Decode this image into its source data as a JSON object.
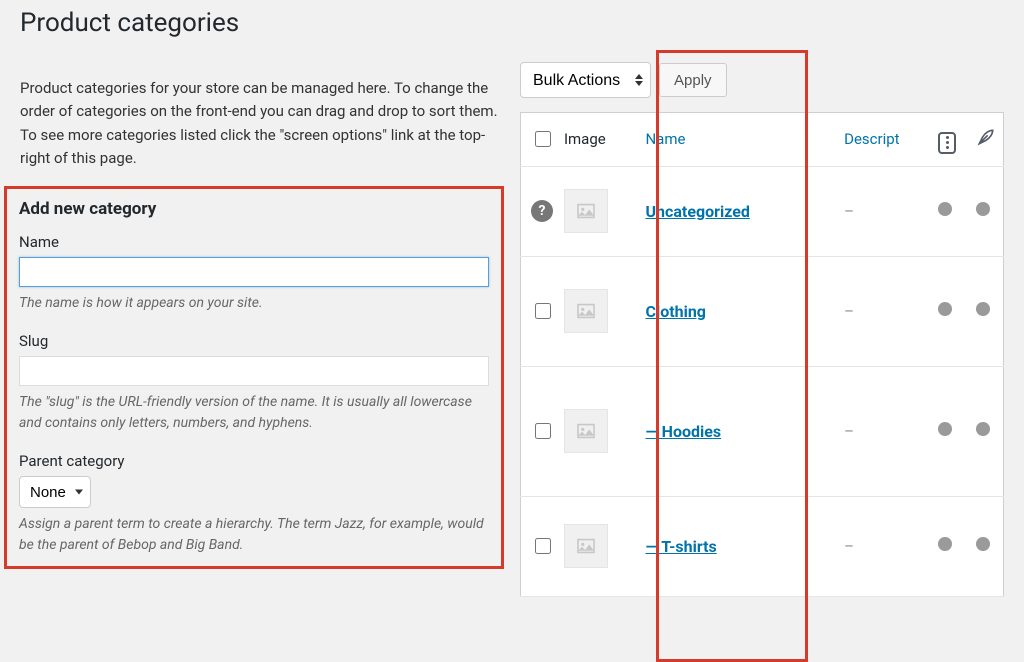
{
  "page": {
    "title": "Product categories",
    "intro": "Product categories for your store can be managed here. To change the order of categories on the front-end you can drag and drop to sort them. To see more categories listed click the \"screen options\" link at the top-right of this page."
  },
  "form": {
    "heading": "Add new category",
    "name": {
      "label": "Name",
      "value": "",
      "help": "The name is how it appears on your site."
    },
    "slug": {
      "label": "Slug",
      "value": "",
      "help": "The \"slug\" is the URL-friendly version of the name. It is usually all lowercase and contains only letters, numbers, and hyphens."
    },
    "parent": {
      "label": "Parent category",
      "selected": "None",
      "help": "Assign a parent term to create a hierarchy. The term Jazz, for example, would be the parent of Bebop and Big Band."
    }
  },
  "tablenav": {
    "bulk_label": "Bulk Actions",
    "apply_label": "Apply"
  },
  "columns": {
    "image": "Image",
    "name": "Name",
    "description": "Descript"
  },
  "rows": [
    {
      "name": "Uncategorized",
      "description": "–",
      "default": true,
      "indent": 0
    },
    {
      "name": "Clothing",
      "description": "–",
      "default": false,
      "indent": 0
    },
    {
      "name": "Hoodies",
      "description": "–",
      "default": false,
      "indent": 1
    },
    {
      "name": "T-shirts",
      "description": "–",
      "default": false,
      "indent": 1
    }
  ]
}
